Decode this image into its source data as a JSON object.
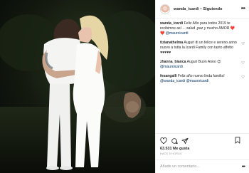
{
  "post": {
    "header": {
      "username": "wanda_icardi",
      "separator": "•",
      "follow_status": "Siguiendo",
      "more": "•••"
    },
    "caption": {
      "username": "wanda_icardi",
      "text": " Feliz Año para todos 2019 te recibimos así ... salud ,paz y mucho AMOR ",
      "emojis": "❤️❤️ ",
      "mention": "@mauroicardi"
    },
    "comments": [
      {
        "username": "tizianathelma",
        "text": " Auguri di un felice e sereno anno nuovo a tutta la Icardi Family con tanto affetto ",
        "hearts": "♥♥♥♥♥"
      },
      {
        "username": "zhanna_bianca",
        "text": " Auguri Buon Anno ",
        "emojis": "😊 ",
        "mention": "@mauroicardi"
      },
      {
        "username": "fesangalli",
        "text": " Feliz año nuevo linda familia! ",
        "mention": "@wanda_icardi @mauroicardi"
      }
    ],
    "likes": "63.531 Me gusta",
    "timestamp": "HACE 5 HORAS",
    "add_comment_placeholder": "Añade un comentario...",
    "add_comment_more": "•••"
  }
}
